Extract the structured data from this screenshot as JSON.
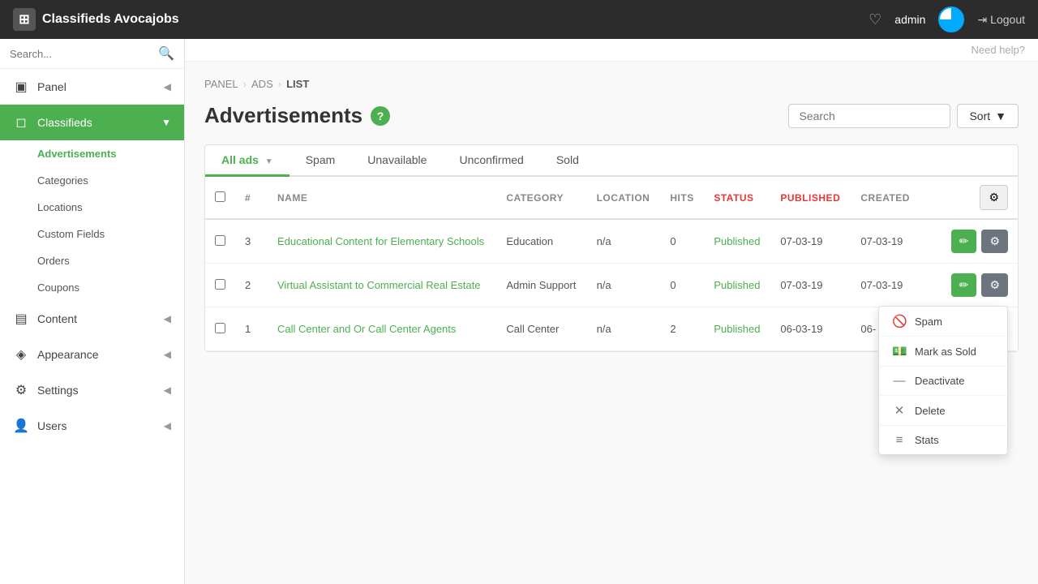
{
  "app": {
    "title": "Classifieds Avocajobs",
    "admin_label": "admin",
    "logout_label": "Logout",
    "help_label": "Need help?"
  },
  "sidebar": {
    "search_placeholder": "Search...",
    "items": [
      {
        "id": "panel",
        "label": "Panel",
        "icon": "▣",
        "arrow": "◀",
        "active": false
      },
      {
        "id": "classifieds",
        "label": "Classifieds",
        "icon": "◻",
        "arrow": "▼",
        "active": true
      },
      {
        "id": "content",
        "label": "Content",
        "icon": "▤",
        "arrow": "◀",
        "active": false
      },
      {
        "id": "appearance",
        "label": "Appearance",
        "icon": "◈",
        "arrow": "◀",
        "active": false
      },
      {
        "id": "settings",
        "label": "Settings",
        "icon": "⚙",
        "arrow": "◀",
        "active": false
      },
      {
        "id": "users",
        "label": "Users",
        "icon": "👤",
        "arrow": "◀",
        "active": false
      }
    ],
    "sub_items": [
      {
        "id": "advertisements",
        "label": "Advertisements",
        "active": true
      },
      {
        "id": "categories",
        "label": "Categories",
        "active": false
      },
      {
        "id": "locations",
        "label": "Locations",
        "active": false
      },
      {
        "id": "custom-fields",
        "label": "Custom Fields",
        "active": false
      },
      {
        "id": "orders",
        "label": "Orders",
        "active": false
      },
      {
        "id": "coupons",
        "label": "Coupons",
        "active": false
      }
    ]
  },
  "breadcrumb": {
    "items": [
      "PANEL",
      "ADS",
      "LIST"
    ]
  },
  "page": {
    "title": "Advertisements",
    "help_icon": "?",
    "search_placeholder": "Search",
    "sort_label": "Sort"
  },
  "tabs": [
    {
      "id": "all-ads",
      "label": "All ads",
      "active": true
    },
    {
      "id": "spam",
      "label": "Spam",
      "active": false
    },
    {
      "id": "unavailable",
      "label": "Unavailable",
      "active": false
    },
    {
      "id": "unconfirmed",
      "label": "Unconfirmed",
      "active": false
    },
    {
      "id": "sold",
      "label": "Sold",
      "active": false
    }
  ],
  "table": {
    "columns": [
      "#",
      "NAME",
      "CATEGORY",
      "LOCATION",
      "HITS",
      "STATUS",
      "PUBLISHED",
      "CREATED"
    ],
    "rows": [
      {
        "id": 3,
        "name": "Educational Content for Elementary Schools",
        "category": "Education",
        "location": "n/a",
        "hits": 0,
        "status": "Published",
        "published": "07-03-19",
        "created": "07-03-19"
      },
      {
        "id": 2,
        "name": "Virtual Assistant to Commercial Real Estate",
        "category": "Admin Support",
        "location": "n/a",
        "hits": 0,
        "status": "Published",
        "published": "07-03-19",
        "created": "07-03-19"
      },
      {
        "id": 1,
        "name": "Call Center and Or Call Center Agents",
        "category": "Call Center",
        "location": "n/a",
        "hits": 2,
        "status": "Published",
        "published": "06-03-19",
        "created": "06-"
      }
    ]
  },
  "dropdown": {
    "items": [
      {
        "id": "spam",
        "label": "Spam",
        "icon": "🚫"
      },
      {
        "id": "mark-as-sold",
        "label": "Mark as Sold",
        "icon": "💵"
      },
      {
        "id": "deactivate",
        "label": "Deactivate",
        "icon": "—"
      },
      {
        "id": "delete",
        "label": "Delete",
        "icon": "✕"
      },
      {
        "id": "stats",
        "label": "Stats",
        "icon": "≡"
      }
    ]
  }
}
